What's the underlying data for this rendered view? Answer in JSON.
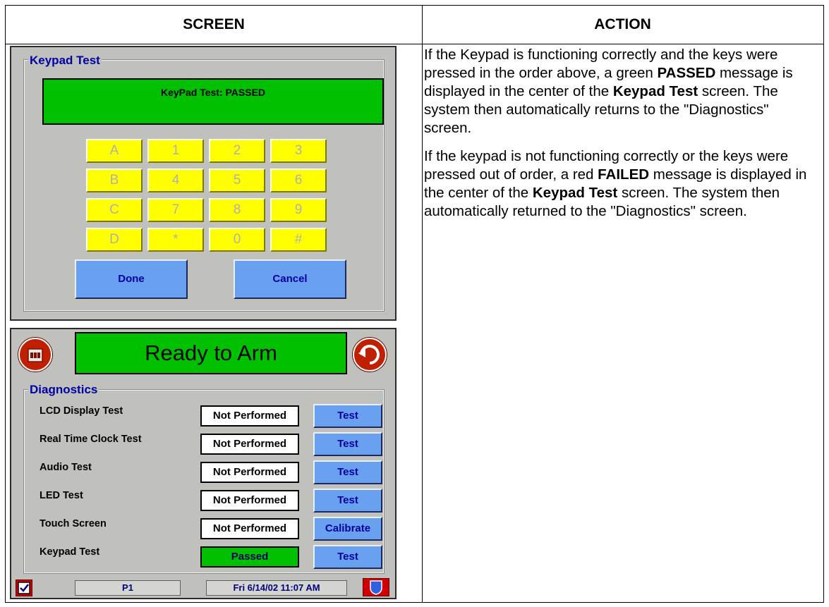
{
  "table": {
    "screen_header": "SCREEN",
    "action_header": "ACTION"
  },
  "action": {
    "p1_a": "If the Keypad is functioning correctly and the keys were pressed in the order above, a green ",
    "p1_b": "PASSED",
    "p1_c": " message is displayed in the center of the ",
    "p1_d": "Keypad Test",
    "p1_e": " screen.  The system then automatically returns to the \"Diagnostics\" screen.",
    "p2_a": "If the keypad is not functioning correctly or the keys were pressed out of order, a red ",
    "p2_b": "FAILED",
    "p2_c": " message is displayed in the center of the ",
    "p2_d": "Keypad Test",
    "p2_e": " screen.  The system then automatically returned to the \"Diagnostics\" screen."
  },
  "keypad_screen": {
    "group_title": "Keypad Test",
    "banner": "KeyPad Test: PASSED",
    "keys": [
      "A",
      "1",
      "2",
      "3",
      "B",
      "4",
      "5",
      "6",
      "C",
      "7",
      "8",
      "9",
      "D",
      "*",
      "0",
      "#"
    ],
    "done_label": "Done",
    "cancel_label": "Cancel",
    "key_color": "#ffff00",
    "banner_color": "#00c000"
  },
  "diagnostics_screen": {
    "banner": "Ready to Arm",
    "group_title": "Diagnostics",
    "rows": [
      {
        "label": "LCD Display Test",
        "status": "Not Performed",
        "button": "Test"
      },
      {
        "label": "Real Time Clock Test",
        "status": "Not Performed",
        "button": "Test"
      },
      {
        "label": "Audio Test",
        "status": "Not Performed",
        "button": "Test"
      },
      {
        "label": "LED Test",
        "status": "Not Performed",
        "button": "Test"
      },
      {
        "label": "Touch Screen",
        "status": "Not Performed",
        "button": "Calibrate"
      },
      {
        "label": "Keypad Test",
        "status": "Passed",
        "button": "Test"
      }
    ],
    "status_bar": {
      "page": "P1",
      "datetime": "Fri 6/14/02 11:07 AM"
    },
    "icons": [
      "home-icon",
      "back-arrow-icon",
      "checkbox-icon",
      "shield-icon"
    ]
  }
}
